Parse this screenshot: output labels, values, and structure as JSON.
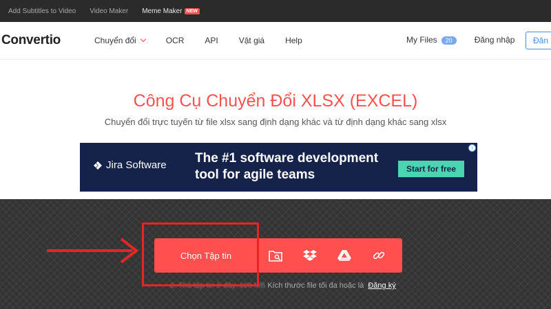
{
  "topbar": {
    "links": [
      "Add Subtitles to Video",
      "Video Maker",
      "Meme Maker"
    ],
    "new_badge": "NEW"
  },
  "header": {
    "logo": "Convertio",
    "nav": [
      "Chuyển đổi",
      "OCR",
      "API",
      "Vật giá",
      "Help"
    ],
    "my_files": "My Files",
    "my_files_count": "20",
    "login": "Đăng nhập",
    "signup": "Đăn"
  },
  "hero": {
    "title": "Công Cụ Chuyển Đổi XLSX (EXCEL)",
    "subtitle": "Chuyển đổi trực tuyến từ file xlsx sang định dạng khác và từ định dạng khác sang xlsx"
  },
  "ad": {
    "brand": "Jira Software",
    "headline_line1": "The #1 software development",
    "headline_line2": "tool for agile teams",
    "cta": "Start for free",
    "info": "i"
  },
  "upload": {
    "choose_file": "Chọn Tập tin",
    "note_prefix": "Kích thước file tối đa hoặc là",
    "note_blurred": "2. Thả tập tin ở đây. 100 MB",
    "note_link": "Đăng ký"
  },
  "colors": {
    "accent": "#ff4f4f",
    "ad_bg": "#15234a",
    "ad_button": "#4bd4b0",
    "annotation": "#e82424"
  }
}
